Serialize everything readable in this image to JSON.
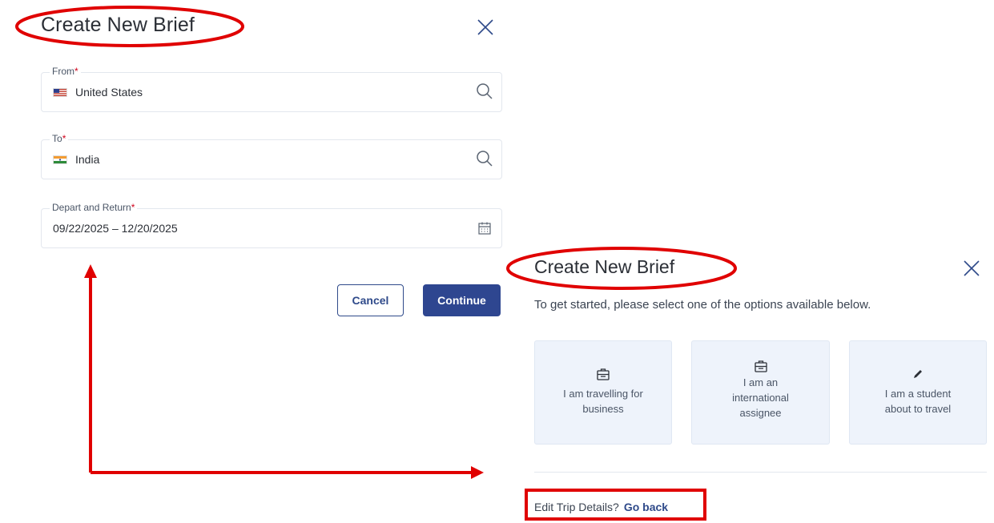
{
  "left_panel": {
    "title": "Create New Brief",
    "from": {
      "label": "From",
      "required_mark": "*",
      "value": "United States"
    },
    "to": {
      "label": "To",
      "required_mark": "*",
      "value": "India"
    },
    "dates": {
      "label": "Depart and Return",
      "required_mark": "*",
      "value": "09/22/2025 – 12/20/2025"
    },
    "cancel_label": "Cancel",
    "continue_label": "Continue"
  },
  "right_panel": {
    "title": "Create New Brief",
    "subtitle": "To get started, please select one of the options available below.",
    "options": [
      {
        "label": "I am travelling for business",
        "icon": "briefcase-icon"
      },
      {
        "label": "I am an international assignee",
        "icon": "briefcase-icon"
      },
      {
        "label": "I am a student about to travel",
        "icon": "pencil-icon"
      }
    ],
    "edit_prompt": "Edit Trip Details?",
    "go_back_label": "Go back"
  },
  "colors": {
    "primary": "#2e4690",
    "required": "#d0021b",
    "annotation": "#e00000",
    "card_bg": "#eef3fb"
  }
}
